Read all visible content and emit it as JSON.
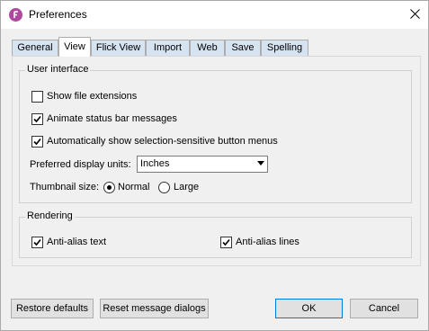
{
  "window": {
    "title": "Preferences"
  },
  "tabs": [
    {
      "label": "General"
    },
    {
      "label": "View",
      "active": true
    },
    {
      "label": "Flick View"
    },
    {
      "label": "Import"
    },
    {
      "label": "Web"
    },
    {
      "label": "Save"
    },
    {
      "label": "Spelling"
    }
  ],
  "user_interface": {
    "title": "User interface",
    "show_file_extensions": {
      "label": "Show file extensions",
      "checked": false
    },
    "animate_status_bar": {
      "label": "Animate status bar messages",
      "checked": true
    },
    "auto_show_menus": {
      "label": "Automatically show selection-sensitive button menus",
      "checked": true
    },
    "display_units": {
      "label": "Preferred display units:",
      "value": "Inches"
    },
    "thumbnail": {
      "label": "Thumbnail size:",
      "options": [
        {
          "label": "Normal",
          "selected": true
        },
        {
          "label": "Large",
          "selected": false
        }
      ]
    }
  },
  "rendering": {
    "title": "Rendering",
    "anti_alias_text": {
      "label": "Anti-alias text",
      "checked": true
    },
    "anti_alias_lines": {
      "label": "Anti-alias lines",
      "checked": true
    }
  },
  "buttons": {
    "restore_defaults": "Restore defaults",
    "reset_dialogs": "Reset message dialogs",
    "ok": "OK",
    "cancel": "Cancel"
  },
  "colors": {
    "accent": "#0078d7",
    "app_icon": "#b0489f",
    "tab_inactive": "#d6e3f1"
  },
  "icons": {
    "app": "app-logo-icon",
    "close": "close-icon",
    "dropdown": "chevron-down-icon",
    "check": "check-icon"
  }
}
